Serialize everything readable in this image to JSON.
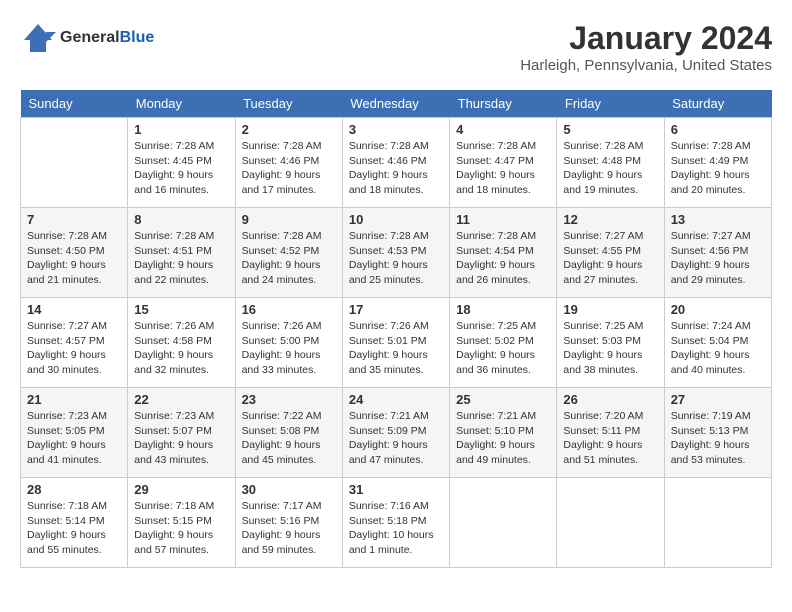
{
  "logo": {
    "general": "General",
    "blue": "Blue"
  },
  "title": "January 2024",
  "location": "Harleigh, Pennsylvania, United States",
  "days_of_week": [
    "Sunday",
    "Monday",
    "Tuesday",
    "Wednesday",
    "Thursday",
    "Friday",
    "Saturday"
  ],
  "weeks": [
    [
      {
        "day": "",
        "info": ""
      },
      {
        "day": "1",
        "info": "Sunrise: 7:28 AM\nSunset: 4:45 PM\nDaylight: 9 hours\nand 16 minutes."
      },
      {
        "day": "2",
        "info": "Sunrise: 7:28 AM\nSunset: 4:46 PM\nDaylight: 9 hours\nand 17 minutes."
      },
      {
        "day": "3",
        "info": "Sunrise: 7:28 AM\nSunset: 4:46 PM\nDaylight: 9 hours\nand 18 minutes."
      },
      {
        "day": "4",
        "info": "Sunrise: 7:28 AM\nSunset: 4:47 PM\nDaylight: 9 hours\nand 18 minutes."
      },
      {
        "day": "5",
        "info": "Sunrise: 7:28 AM\nSunset: 4:48 PM\nDaylight: 9 hours\nand 19 minutes."
      },
      {
        "day": "6",
        "info": "Sunrise: 7:28 AM\nSunset: 4:49 PM\nDaylight: 9 hours\nand 20 minutes."
      }
    ],
    [
      {
        "day": "7",
        "info": "Sunrise: 7:28 AM\nSunset: 4:50 PM\nDaylight: 9 hours\nand 21 minutes."
      },
      {
        "day": "8",
        "info": "Sunrise: 7:28 AM\nSunset: 4:51 PM\nDaylight: 9 hours\nand 22 minutes."
      },
      {
        "day": "9",
        "info": "Sunrise: 7:28 AM\nSunset: 4:52 PM\nDaylight: 9 hours\nand 24 minutes."
      },
      {
        "day": "10",
        "info": "Sunrise: 7:28 AM\nSunset: 4:53 PM\nDaylight: 9 hours\nand 25 minutes."
      },
      {
        "day": "11",
        "info": "Sunrise: 7:28 AM\nSunset: 4:54 PM\nDaylight: 9 hours\nand 26 minutes."
      },
      {
        "day": "12",
        "info": "Sunrise: 7:27 AM\nSunset: 4:55 PM\nDaylight: 9 hours\nand 27 minutes."
      },
      {
        "day": "13",
        "info": "Sunrise: 7:27 AM\nSunset: 4:56 PM\nDaylight: 9 hours\nand 29 minutes."
      }
    ],
    [
      {
        "day": "14",
        "info": "Sunrise: 7:27 AM\nSunset: 4:57 PM\nDaylight: 9 hours\nand 30 minutes."
      },
      {
        "day": "15",
        "info": "Sunrise: 7:26 AM\nSunset: 4:58 PM\nDaylight: 9 hours\nand 32 minutes."
      },
      {
        "day": "16",
        "info": "Sunrise: 7:26 AM\nSunset: 5:00 PM\nDaylight: 9 hours\nand 33 minutes."
      },
      {
        "day": "17",
        "info": "Sunrise: 7:26 AM\nSunset: 5:01 PM\nDaylight: 9 hours\nand 35 minutes."
      },
      {
        "day": "18",
        "info": "Sunrise: 7:25 AM\nSunset: 5:02 PM\nDaylight: 9 hours\nand 36 minutes."
      },
      {
        "day": "19",
        "info": "Sunrise: 7:25 AM\nSunset: 5:03 PM\nDaylight: 9 hours\nand 38 minutes."
      },
      {
        "day": "20",
        "info": "Sunrise: 7:24 AM\nSunset: 5:04 PM\nDaylight: 9 hours\nand 40 minutes."
      }
    ],
    [
      {
        "day": "21",
        "info": "Sunrise: 7:23 AM\nSunset: 5:05 PM\nDaylight: 9 hours\nand 41 minutes."
      },
      {
        "day": "22",
        "info": "Sunrise: 7:23 AM\nSunset: 5:07 PM\nDaylight: 9 hours\nand 43 minutes."
      },
      {
        "day": "23",
        "info": "Sunrise: 7:22 AM\nSunset: 5:08 PM\nDaylight: 9 hours\nand 45 minutes."
      },
      {
        "day": "24",
        "info": "Sunrise: 7:21 AM\nSunset: 5:09 PM\nDaylight: 9 hours\nand 47 minutes."
      },
      {
        "day": "25",
        "info": "Sunrise: 7:21 AM\nSunset: 5:10 PM\nDaylight: 9 hours\nand 49 minutes."
      },
      {
        "day": "26",
        "info": "Sunrise: 7:20 AM\nSunset: 5:11 PM\nDaylight: 9 hours\nand 51 minutes."
      },
      {
        "day": "27",
        "info": "Sunrise: 7:19 AM\nSunset: 5:13 PM\nDaylight: 9 hours\nand 53 minutes."
      }
    ],
    [
      {
        "day": "28",
        "info": "Sunrise: 7:18 AM\nSunset: 5:14 PM\nDaylight: 9 hours\nand 55 minutes."
      },
      {
        "day": "29",
        "info": "Sunrise: 7:18 AM\nSunset: 5:15 PM\nDaylight: 9 hours\nand 57 minutes."
      },
      {
        "day": "30",
        "info": "Sunrise: 7:17 AM\nSunset: 5:16 PM\nDaylight: 9 hours\nand 59 minutes."
      },
      {
        "day": "31",
        "info": "Sunrise: 7:16 AM\nSunset: 5:18 PM\nDaylight: 10 hours\nand 1 minute."
      },
      {
        "day": "",
        "info": ""
      },
      {
        "day": "",
        "info": ""
      },
      {
        "day": "",
        "info": ""
      }
    ]
  ]
}
